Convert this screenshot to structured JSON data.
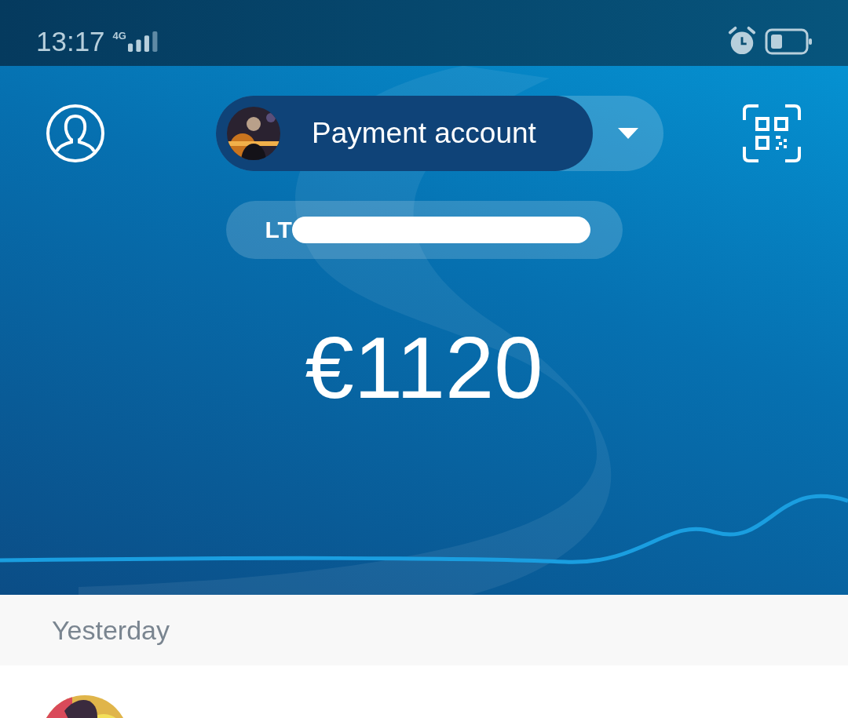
{
  "status_bar": {
    "time": "13:17",
    "network": "4G"
  },
  "account": {
    "name": "Payment account",
    "iban": "LT"
  },
  "balance": "€1120",
  "sections": [
    {
      "title": "Yesterday"
    }
  ]
}
